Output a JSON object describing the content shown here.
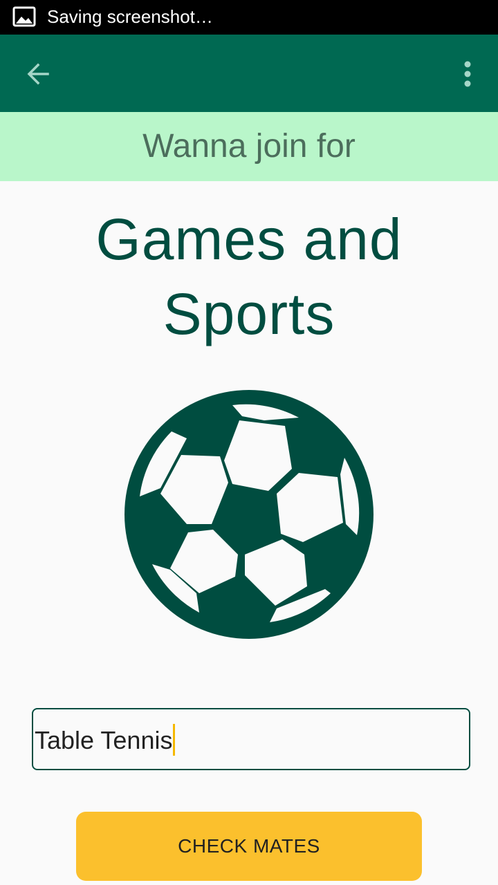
{
  "status_bar": {
    "notification_icon": "image-icon",
    "text": "Saving screenshot…"
  },
  "app_bar": {
    "back_icon": "arrow-back-icon",
    "menu_icon": "more-vert-icon"
  },
  "banner": {
    "text": "Wanna join for"
  },
  "heading": {
    "line1": "Games and",
    "line2": "Sports"
  },
  "illustration": {
    "icon": "soccer-ball-icon"
  },
  "sport_input": {
    "value": "Table Tennis"
  },
  "check_button": {
    "label": "CHECK MATES"
  },
  "colors": {
    "primary": "#006952",
    "banner": "#b9f6ca",
    "accent": "#fbc02d",
    "dark_green": "#004d40"
  }
}
